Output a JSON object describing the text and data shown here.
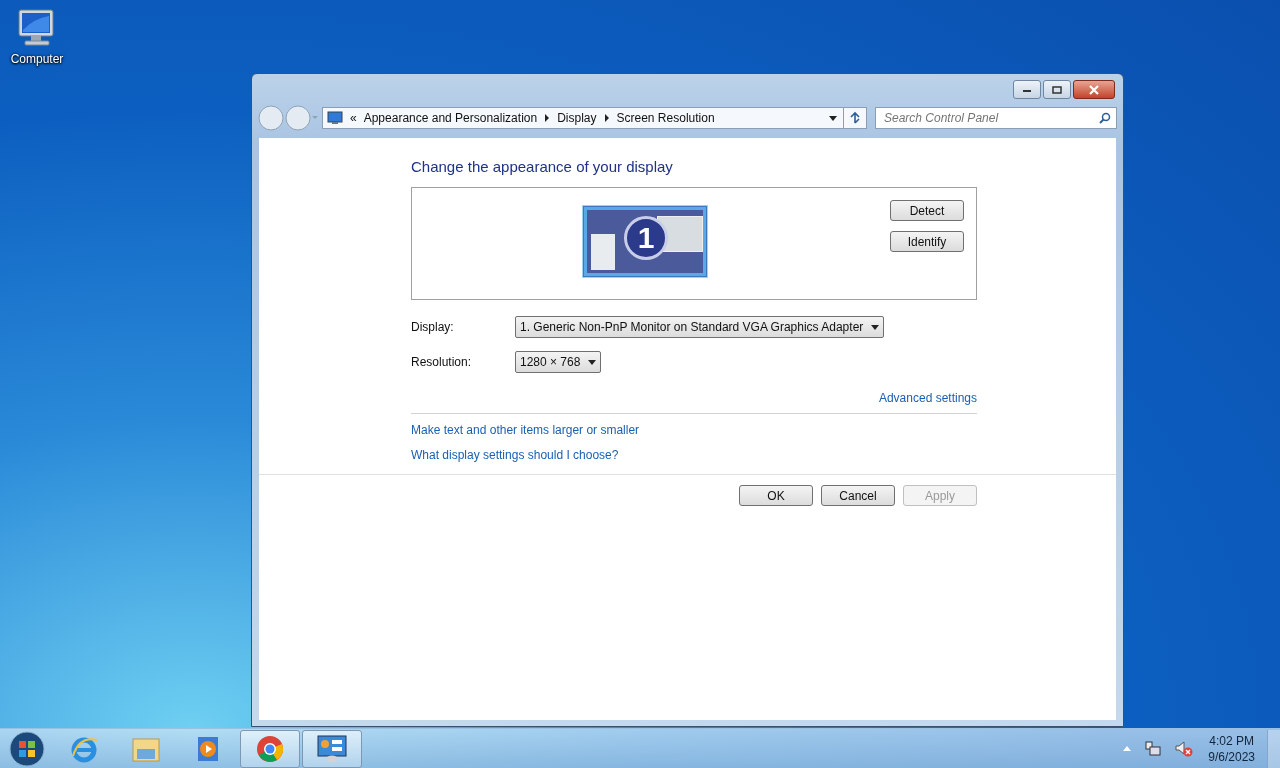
{
  "desktop_icons": [
    {
      "label": "Computer"
    }
  ],
  "window": {
    "nav": {
      "prefix": "«",
      "breadcrumb": [
        "Appearance and Personalization",
        "Display",
        "Screen Resolution"
      ]
    },
    "search": {
      "placeholder": "Search Control Panel"
    },
    "heading": "Change the appearance of your display",
    "monitor": {
      "number": "1",
      "selected": true
    },
    "side_buttons": [
      "Detect",
      "Identify"
    ],
    "fields": [
      {
        "label": "Display:",
        "value": "1. Generic Non-PnP Monitor on Standard VGA Graphics Adapter"
      },
      {
        "label": "Resolution:",
        "value": "1280 × 768"
      }
    ],
    "advanced_link": "Advanced settings",
    "links": [
      "Make text and other items larger or smaller",
      "What display settings should I choose?"
    ],
    "buttons": [
      {
        "label": "OK",
        "disabled": false
      },
      {
        "label": "Cancel",
        "disabled": false
      },
      {
        "label": "Apply",
        "disabled": true
      }
    ]
  },
  "taskbar": {
    "items": [
      {
        "kind": "ie",
        "running": false
      },
      {
        "kind": "explorer",
        "running": false
      },
      {
        "kind": "media",
        "running": false
      },
      {
        "kind": "chrome",
        "running": true
      },
      {
        "kind": "control",
        "running": true
      }
    ],
    "time": "4:02 PM",
    "date": "9/6/2023"
  }
}
